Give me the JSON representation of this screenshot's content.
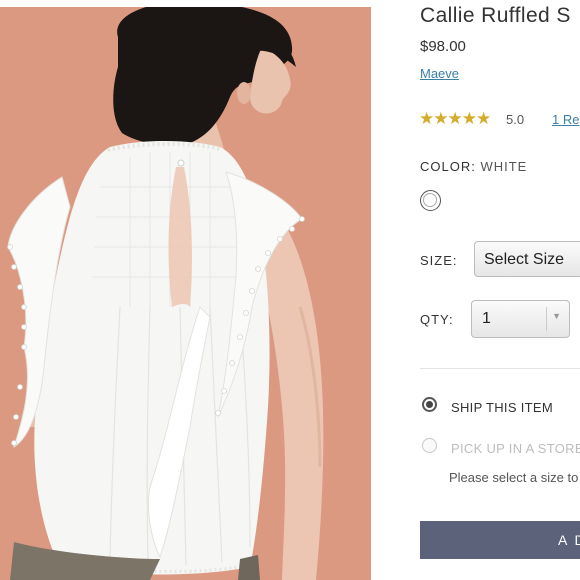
{
  "product": {
    "title": "Callie Ruffled S",
    "price": "$98.00",
    "brand": "Maeve",
    "stars": "★★★★★",
    "rating": "5.0",
    "reviews_link": "1 Re"
  },
  "color": {
    "label": "COLOR:",
    "value": "WHITE",
    "swatch_color": "#ffffff"
  },
  "size": {
    "label": "SIZE:",
    "selected": "Select Size"
  },
  "qty": {
    "label": "QTY:",
    "selected": "1"
  },
  "fulfillment": {
    "ship_label": "SHIP THIS ITEM",
    "pickup_label": "PICK UP IN A STORE",
    "hint": "Please select a size to"
  },
  "actions": {
    "add_label": "A D"
  },
  "colors": {
    "link": "#3a7fa4",
    "star": "#d4ab2a",
    "button": "#5b6279",
    "photo_background": "#d9957f"
  }
}
